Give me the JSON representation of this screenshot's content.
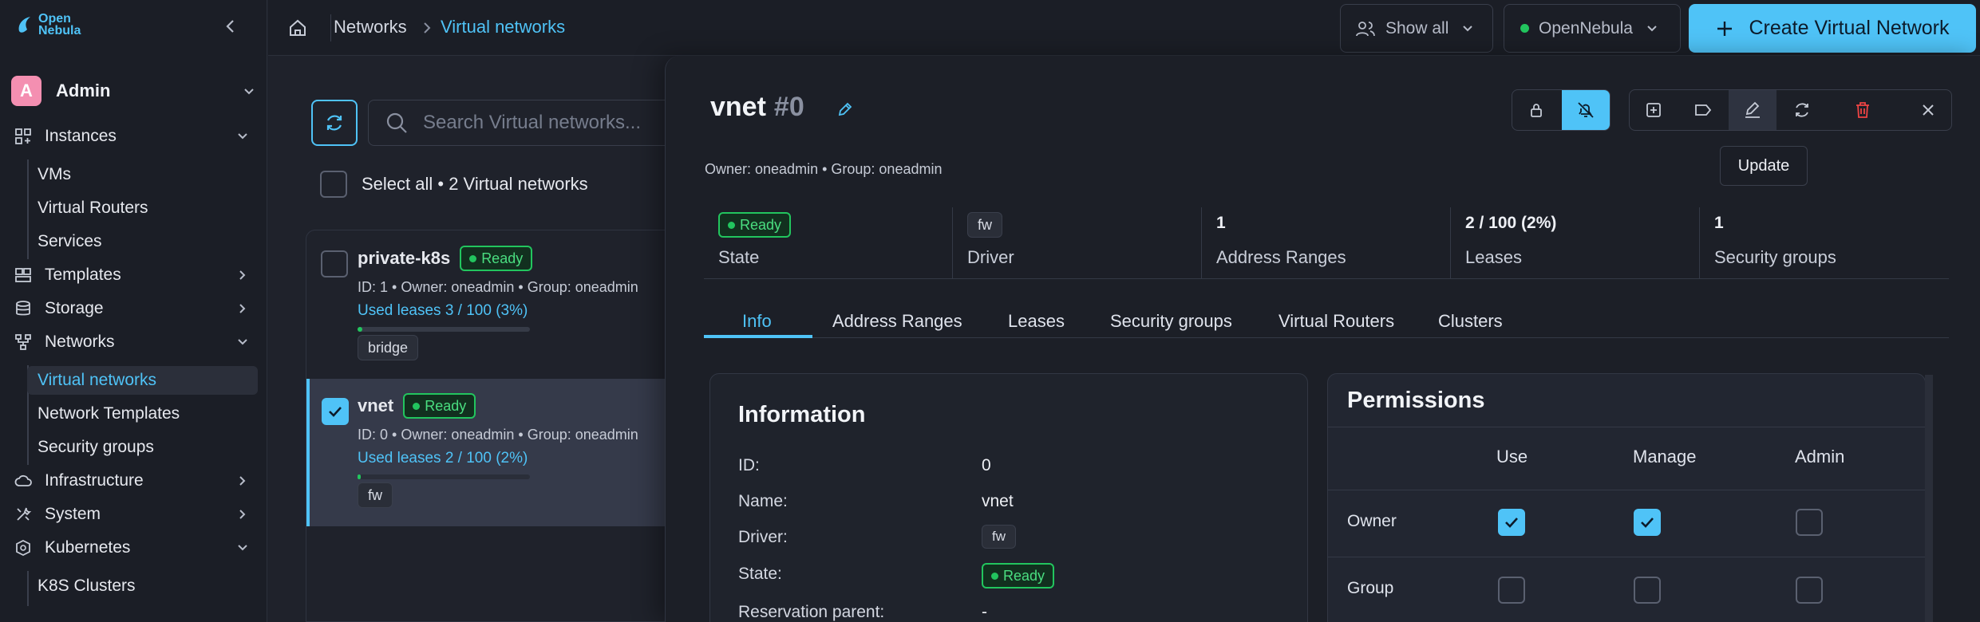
{
  "sidebar": {
    "logo_line1": "Open",
    "logo_line2": "Nebula",
    "user": {
      "initial": "A",
      "name": "Admin"
    },
    "items": [
      {
        "label": "Instances"
      },
      {
        "label": "VMs"
      },
      {
        "label": "Virtual Routers"
      },
      {
        "label": "Services"
      },
      {
        "label": "Templates"
      },
      {
        "label": "Storage"
      },
      {
        "label": "Networks"
      },
      {
        "label": "Virtual networks"
      },
      {
        "label": "Network Templates"
      },
      {
        "label": "Security groups"
      },
      {
        "label": "Infrastructure"
      },
      {
        "label": "System"
      },
      {
        "label": "Kubernetes"
      },
      {
        "label": "K8S Clusters"
      }
    ]
  },
  "topbar": {
    "crumb_root": "Networks",
    "crumb_current": "Virtual networks",
    "show_all": "Show all",
    "zone": "OpenNebula",
    "create": "Create Virtual Network"
  },
  "list": {
    "search_placeholder": "Search Virtual networks...",
    "select_all": "Select all • 2 Virtual networks",
    "rows": [
      {
        "name": "private-k8s",
        "status": "Ready",
        "id": "ID: 1",
        "owner": "Owner: oneadmin",
        "group": "Group: oneadmin",
        "leases": "Used leases 3 / 100 (3%)",
        "leases_fraction": 0.03,
        "driver": "bridge"
      },
      {
        "name": "vnet",
        "status": "Ready",
        "id": "ID: 0",
        "owner": "Owner: oneadmin",
        "group": "Group: oneadmin",
        "leases": "Used leases 2 / 100 (2%)",
        "leases_fraction": 0.02,
        "driver": "fw"
      }
    ]
  },
  "detail": {
    "name": "vnet",
    "id": "#0",
    "owner": "Owner: oneadmin",
    "group": "Group: oneadmin",
    "tooltip": "Update",
    "stats": [
      {
        "value": "Ready",
        "label": "State"
      },
      {
        "value": "fw",
        "label": "Driver"
      },
      {
        "value": "1",
        "label": "Address Ranges"
      },
      {
        "value": "2 / 100 (2%)",
        "label": "Leases"
      },
      {
        "value": "1",
        "label": "Security groups"
      }
    ],
    "tabs": [
      "Info",
      "Address Ranges",
      "Leases",
      "Security groups",
      "Virtual Routers",
      "Clusters"
    ],
    "info": {
      "title": "Information",
      "rows": [
        {
          "label": "ID:",
          "value": "0"
        },
        {
          "label": "Name:",
          "value": "vnet"
        },
        {
          "label": "Driver:",
          "value": "fw"
        },
        {
          "label": "State:",
          "value": "Ready"
        },
        {
          "label": "Reservation parent:",
          "value": "-"
        }
      ]
    },
    "permissions": {
      "title": "Permissions",
      "columns": [
        "Use",
        "Manage",
        "Admin"
      ],
      "rows": [
        {
          "label": "Owner",
          "use": true,
          "manage": true,
          "admin": false
        },
        {
          "label": "Group",
          "use": false,
          "manage": false,
          "admin": false
        }
      ]
    }
  },
  "colors": {
    "accent": "#4fc3f7",
    "ready": "#22c55e",
    "danger": "#ef4444"
  }
}
